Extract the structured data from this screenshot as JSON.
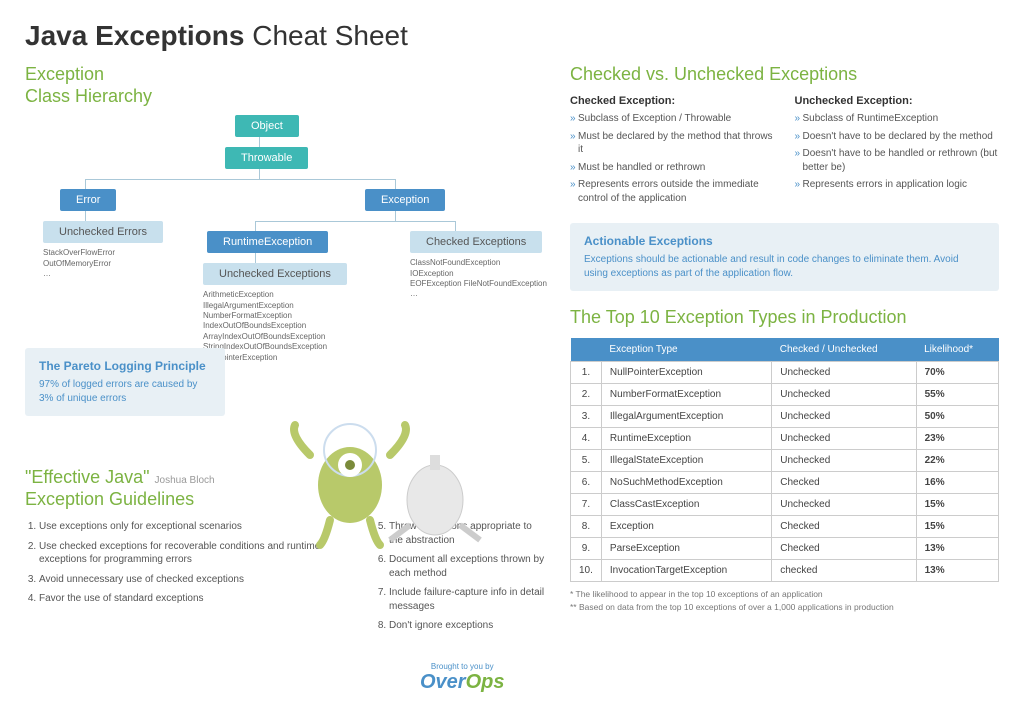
{
  "title_bold": "Java Exceptions",
  "title_rest": " Cheat Sheet",
  "hierarchy_title_l1": "Exception",
  "hierarchy_title_l2": "Class Hierarchy",
  "nodes": {
    "object": "Object",
    "throwable": "Throwable",
    "error": "Error",
    "exception": "Exception",
    "unchecked_errors": "Unchecked Errors",
    "runtime_exception": "RuntimeException",
    "checked_exceptions": "Checked Exceptions",
    "unchecked_exceptions": "Unchecked Exceptions"
  },
  "error_list": "StackOverFlowError\nOutOfMemoryError\n…",
  "checked_list": "ClassNotFoundException\nIOException\nEOFException FileNotFoundException\n…",
  "unchecked_list": "ArithmeticException\nIllegalArgumentException\nNumberFormatException\nIndexOutOfBoundsException\nArrayIndexOutOfBoundsException\nStringIndexOutOfBoundsException\nNullPointerException\n…",
  "pareto_title": "The Pareto Logging Principle",
  "pareto_body": "97% of logged errors are caused by 3% of unique errors",
  "guidelines_title_l1": "\"Effective Java\"",
  "guidelines_author": "Joshua Bloch",
  "guidelines_title_l2": "Exception Guidelines",
  "guide1": [
    "Use exceptions only for exceptional scenarios",
    "Use checked exceptions for recoverable conditions and runtime exceptions for programming errors",
    "Avoid unnecessary use of checked exceptions",
    "Favor the use of standard exceptions"
  ],
  "guide2": [
    "Throw exceptions appropriate to the abstraction",
    "Document all exceptions thrown by each method",
    "Include failure-capture info in detail messages",
    "Don't ignore exceptions"
  ],
  "cvu_title": "Checked vs. Unchecked Exceptions",
  "checked_h": "Checked Exception:",
  "unchecked_h": "Unchecked Exception:",
  "checked_pts": [
    "Subclass of Exception / Throwable",
    "Must be declared by the method that throws it",
    "Must be handled or rethrown",
    "Represents errors outside the immediate control of the application"
  ],
  "unchecked_pts": [
    "Subclass of RuntimeException",
    "Doesn't have to be declared by the method",
    "Doesn't have to be handled or rethrown (but better be)",
    "Represents errors in application logic"
  ],
  "actionable_title": "Actionable Exceptions",
  "actionable_body": "Exceptions should be actionable and result in code changes to eliminate them. Avoid using exceptions as part of the application flow.",
  "top10_title": "The Top 10 Exception Types in Production",
  "th_type": "Exception Type",
  "th_check": "Checked / Unchecked",
  "th_like": "Likelihood*",
  "rows": [
    [
      "1.",
      "NullPointerException",
      "Unchecked",
      "70%"
    ],
    [
      "2.",
      "NumberFormatException",
      "Unchecked",
      "55%"
    ],
    [
      "3.",
      "IllegalArgumentException",
      "Unchecked",
      "50%"
    ],
    [
      "4.",
      "RuntimeException",
      "Unchecked",
      "23%"
    ],
    [
      "5.",
      "IllegalStateException",
      "Unchecked",
      "22%"
    ],
    [
      "6.",
      "NoSuchMethodException",
      "Checked",
      "16%"
    ],
    [
      "7.",
      "ClassCastException",
      "Unchecked",
      "15%"
    ],
    [
      "8.",
      "Exception",
      "Checked",
      "15%"
    ],
    [
      "9.",
      "ParseException",
      "Checked",
      "13%"
    ],
    [
      "10.",
      "InvocationTargetException",
      "checked",
      "13%"
    ]
  ],
  "foot1": "* The likelihood to appear in the top 10 exceptions of an application",
  "foot2": "** Based on data from the top 10 exceptions of over a 1,000 applications in production",
  "brought": "Brought to you by",
  "brand1": "Over",
  "brand2": "Ops"
}
